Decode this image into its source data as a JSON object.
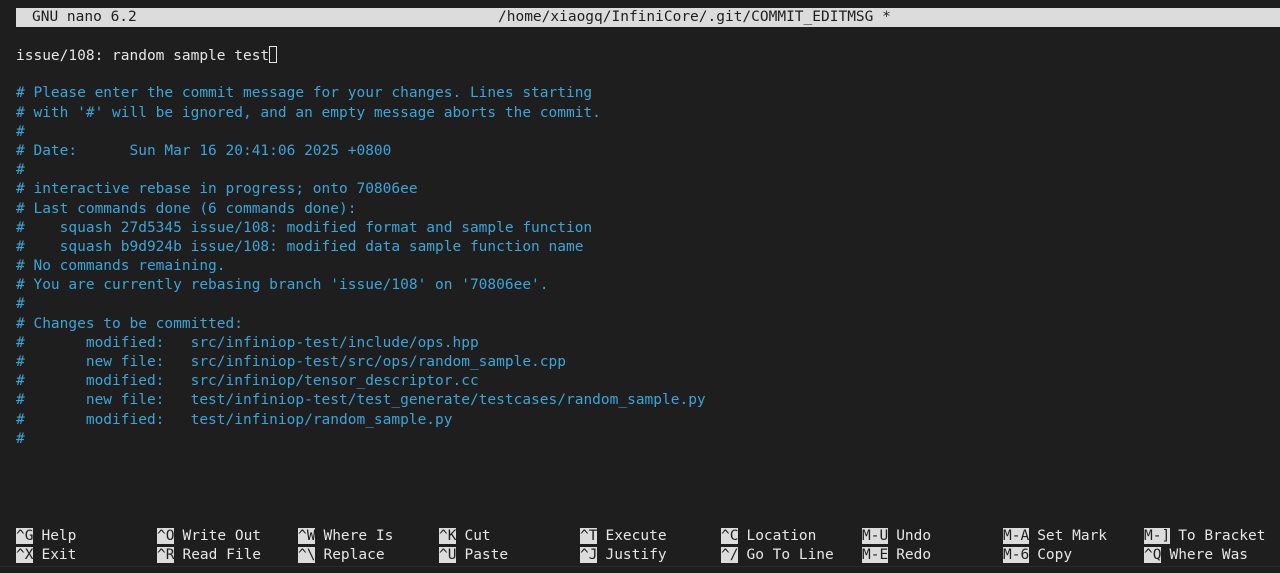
{
  "titlebar": {
    "app": "GNU nano 6.2",
    "file": "/home/xiaogq/InfiniCore/.git/COMMIT_EDITMSG *"
  },
  "editor": {
    "first_line": "issue/108: random sample test",
    "blank": "",
    "comments": [
      "# Please enter the commit message for your changes. Lines starting",
      "# with '#' will be ignored, and an empty message aborts the commit.",
      "#",
      "# Date:      Sun Mar 16 20:41:06 2025 +0800",
      "#",
      "# interactive rebase in progress; onto 70806ee",
      "# Last commands done (6 commands done):",
      "#    squash 27d5345 issue/108: modified format and sample function",
      "#    squash b9d924b issue/108: modified data sample function name",
      "# No commands remaining.",
      "# You are currently rebasing branch 'issue/108' on '70806ee'.",
      "#",
      "# Changes to be committed:",
      "#\tmodified:   src/infiniop-test/include/ops.hpp",
      "#\tnew file:   src/infiniop-test/src/ops/random_sample.cpp",
      "#\tmodified:   src/infiniop/tensor_descriptor.cc",
      "#\tnew file:   test/infiniop-test/test_generate/testcases/random_sample.py",
      "#\tmodified:   test/infiniop/random_sample.py",
      "#"
    ]
  },
  "shortcuts": {
    "row1": [
      {
        "key": "^G",
        "label": "Help"
      },
      {
        "key": "^O",
        "label": "Write Out"
      },
      {
        "key": "^W",
        "label": "Where Is"
      },
      {
        "key": "^K",
        "label": "Cut"
      },
      {
        "key": "^T",
        "label": "Execute"
      },
      {
        "key": "^C",
        "label": "Location"
      },
      {
        "key": "M-U",
        "label": "Undo"
      },
      {
        "key": "M-A",
        "label": "Set Mark"
      },
      {
        "key": "M-]",
        "label": "To Bracket"
      }
    ],
    "row2": [
      {
        "key": "^X",
        "label": "Exit"
      },
      {
        "key": "^R",
        "label": "Read File"
      },
      {
        "key": "^\\",
        "label": "Replace"
      },
      {
        "key": "^U",
        "label": "Paste"
      },
      {
        "key": "^J",
        "label": "Justify"
      },
      {
        "key": "^/",
        "label": "Go To Line"
      },
      {
        "key": "M-E",
        "label": "Redo"
      },
      {
        "key": "M-6",
        "label": "Copy"
      },
      {
        "key": "^Q",
        "label": "Where Was"
      }
    ]
  },
  "colors": {
    "background": "#1e1e1e",
    "comment": "#3aa6d8",
    "inverse_bg": "#dcdcdc"
  }
}
